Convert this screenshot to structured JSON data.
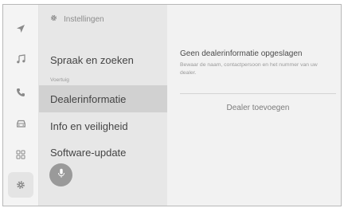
{
  "header": {
    "title": "Instellingen",
    "icon": "gear-icon"
  },
  "iconbar": [
    {
      "name": "navigation-icon"
    },
    {
      "name": "music-icon"
    },
    {
      "name": "phone-icon"
    },
    {
      "name": "car-icon"
    },
    {
      "name": "apps-icon"
    },
    {
      "name": "settings-icon",
      "active": true
    }
  ],
  "menu": {
    "items": [
      {
        "label": "Spraak en zoeken"
      },
      {
        "label": "Dealerinformatie",
        "selected": true
      },
      {
        "label": "Info en veiligheid"
      },
      {
        "label": "Software-update"
      }
    ],
    "section_label": "Voertuig"
  },
  "content": {
    "title": "Geen dealerinformatie opgeslagen",
    "description": "Bewaar de naam, contactpersoon en het nummer van uw dealer.",
    "add_button": "Dealer toevoegen"
  },
  "colors": {
    "selected_bg": "#d1d1d1",
    "menu_bg": "#e7e7e7",
    "content_bg": "#f2f2f2"
  }
}
